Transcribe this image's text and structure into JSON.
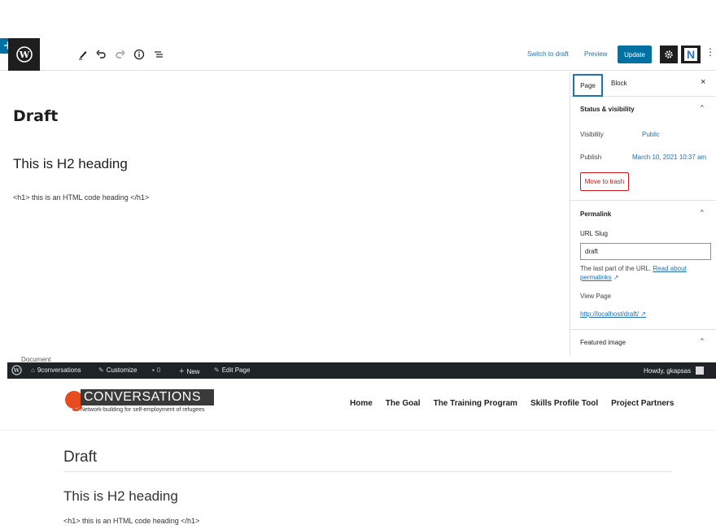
{
  "toolbar": {
    "switch_to_draft": "Switch to draft",
    "preview": "Preview",
    "update": "Update",
    "add_block": "+",
    "n_logo": "N"
  },
  "editor": {
    "title": "Draft",
    "h2": "This is H2 heading",
    "paragraph": "<h1> this is an HTML code heading </h1>"
  },
  "sidebar": {
    "tab_page": "Page",
    "tab_block": "Block",
    "close": "×",
    "status_panel": {
      "title": "Status & visibility",
      "visibility_label": "Visibility",
      "visibility_value": "Public",
      "publish_label": "Publish",
      "publish_value": "March 10, 2021 10:37 am",
      "trash": "Move to trash"
    },
    "permalink_panel": {
      "title": "Permalink",
      "slug_label": "URL Slug",
      "slug_value": "draft",
      "help_text": "The last part of the URL.",
      "help_link_1": "Read about",
      "help_link_2": "permalinks",
      "view_page_label": "View Page",
      "view_page_url": "http://localhost/draft/"
    },
    "featured_panel": {
      "title": "Featured image"
    }
  },
  "document_label": "Document",
  "admin_bar": {
    "site_name": "9conversations",
    "customize": "Customize",
    "comments_count": "0",
    "new": "New",
    "edit_page": "Edit Page",
    "howdy": "Howdy, gkapsas"
  },
  "site": {
    "logo_word": "CONVERSATIONS",
    "logo_tagline": "Network-building for self-employment of refugees",
    "nav": [
      "Home",
      "The Goal",
      "The Training Program",
      "Skills Profile Tool",
      "Project Partners"
    ],
    "title": "Draft",
    "h2": "This is H2 heading",
    "paragraph": "<h1> this is an HTML code heading </h1>"
  },
  "colors": {
    "wp_blue": "#0071a1",
    "admin_bar": "#1d2327",
    "trash_red": "#cc1818",
    "logo_orange": "#e84c1e"
  }
}
